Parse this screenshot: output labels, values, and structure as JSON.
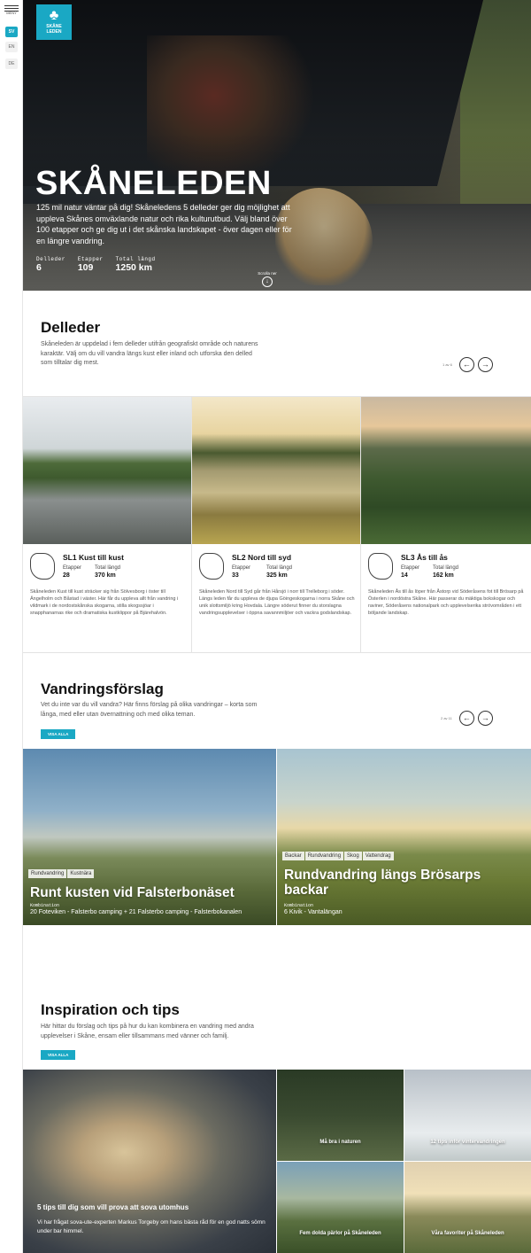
{
  "sidebar": {
    "menu_label": "MENY",
    "languages": [
      "SV",
      "EN",
      "DE"
    ],
    "active_language": "SV"
  },
  "logo": {
    "line1": "SKÅNE",
    "line2": "LEDEN"
  },
  "hero": {
    "title": "SKÅNELEDEN",
    "lead": "125 mil natur väntar på dig! Skåneledens 5 delleder ger dig möjlighet att uppleva Skånes omväxlande natur och rika kulturutbud. Välj bland över 100 etapper och ge dig ut i det skånska landskapet - över dagen eller för en längre vandring.",
    "stats": [
      {
        "label": "Delleder",
        "value": "6"
      },
      {
        "label": "Etapper",
        "value": "109"
      },
      {
        "label": "Total längd",
        "value": "1250 km"
      }
    ],
    "scroll_label": "Scrolla ner"
  },
  "delleder": {
    "title": "Delleder",
    "text": "Skåneleden är uppdelad i fem delleder utifrån geografiskt område och naturens karaktär. Välj om du vill vandra längs kust eller inland och utforska den delled som tilltalar dig mest.",
    "pager": "1 av 6",
    "cards": [
      {
        "name": "SL1 Kust till kust",
        "etapper_label": "Etapper",
        "etapper": "28",
        "length_label": "Total längd",
        "length": "370 km",
        "desc": "Skåneleden Kust till kust sträcker sig från Sölvesborg i öster till Ängelholm och Båstad i väster. Här får du uppleva allt från vandring i vildmark i de nordostskånska skogarna, stilla skogssjöar i snapphanarnas rike och dramatiska kustklippor på Bjärehalvön."
      },
      {
        "name": "SL2 Nord till syd",
        "etapper_label": "Etapper",
        "etapper": "33",
        "length_label": "Total längd",
        "length": "325 km",
        "desc": "Skåneleden Nord till Syd går från Hårsjö i norr till Trelleborg i söder. Längs leden får du uppleva de djupa Göingeskogarna i norra Skåne och unik slottsmiljö kring Hovdala. Längre söderut finner du storslagna vandringsupplevelser i öppna savannmiljöer och vackra godslandskap."
      },
      {
        "name": "SL3 Ås till ås",
        "etapper_label": "Etapper",
        "etapper": "14",
        "length_label": "Total längd",
        "length": "162 km",
        "desc": "Skåneleden Ås till ås löper från Åstorp vid Söderåsens fot till Brösarp på Österlen i nordöstra Skåne. Här passerar du mäktiga bokskogar och raviner, Söderåsens nationalpark och upplevelserika strövområden i ett böljande landskap."
      }
    ]
  },
  "vandring": {
    "title": "Vandringsförslag",
    "text": "Vet du inte var du vill vandra? Här finns förslag på olika vandringar – korta som långa, med eller utan övernattning och med olika teman.",
    "button": "VISA ALLA",
    "pager": "2 av 11",
    "cards": [
      {
        "tags": [
          "Rundvandring",
          "Kustnära"
        ],
        "title": "Runt kusten vid Falsterbonäset",
        "combo_label": "Kombination",
        "combo": "20 Foteviken - Falsterbo camping + 21 Falsterbo camping - Falsterbokanalen"
      },
      {
        "tags": [
          "Backar",
          "Rundvandring",
          "Skog",
          "Vattendrag"
        ],
        "title": "Rundvandring längs Brösarps backar",
        "combo_label": "Kombination",
        "combo": "6 Kivik - Vantalängan"
      }
    ]
  },
  "inspiration": {
    "title": "Inspiration och tips",
    "text": "Här hittar du förslag och tips på hur du kan kombinera en vandring med andra upplevelser i Skåne, ensam eller tillsammans med vänner och familj.",
    "button": "VISA ALLA",
    "main": {
      "title": "5 tips till dig som vill prova att sova utomhus",
      "desc": "Vi har frågat sova-ute-experten Markus Torgeby om hans bästa råd för en god natts sömn under bar himmel."
    },
    "cards": [
      {
        "title": "Må bra i naturen"
      },
      {
        "title": "12 tips inför vintervandringen"
      },
      {
        "title": "Fem dolda pärlor på Skåneleden"
      },
      {
        "title": "Våra favoriter på Skåneleden"
      }
    ]
  }
}
